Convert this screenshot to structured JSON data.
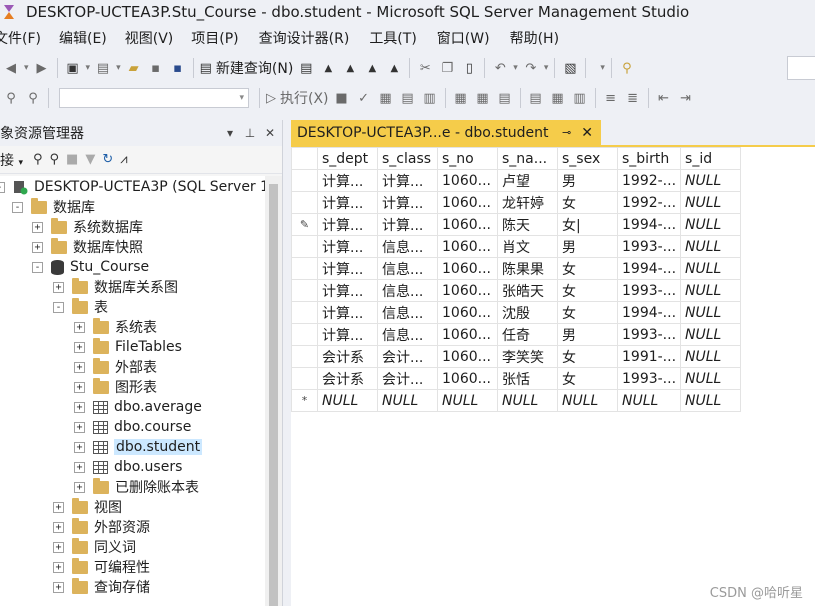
{
  "window": {
    "title": "DESKTOP-UCTEA3P.Stu_Course - dbo.student - Microsoft SQL Server Management Studio"
  },
  "menu": [
    "文件(F)",
    "编辑(E)",
    "视图(V)",
    "项目(P)",
    "查询设计器(R)",
    "工具(T)",
    "窗口(W)",
    "帮助(H)"
  ],
  "toolbar": {
    "new_query_label": "新建查询(N)",
    "execute_label": "执行(X)"
  },
  "object_explorer": {
    "title": "对象资源管理器",
    "connect_label": "连接",
    "tree": [
      {
        "label": "DESKTOP-UCTEA3P (SQL Server 1",
        "expander": "-"
      },
      {
        "label": "数据库",
        "expander": "-"
      },
      {
        "label": "系统数据库",
        "expander": "+"
      },
      {
        "label": "数据库快照",
        "expander": "+"
      },
      {
        "label": "Stu_Course",
        "expander": "-"
      },
      {
        "label": "数据库关系图",
        "expander": "+"
      },
      {
        "label": "表",
        "expander": "-"
      },
      {
        "label": "系统表",
        "expander": "+"
      },
      {
        "label": "FileTables",
        "expander": "+"
      },
      {
        "label": "外部表",
        "expander": "+"
      },
      {
        "label": "图形表",
        "expander": "+"
      },
      {
        "label": "dbo.average",
        "expander": "+"
      },
      {
        "label": "dbo.course",
        "expander": "+"
      },
      {
        "label": "dbo.student",
        "expander": "+"
      },
      {
        "label": "dbo.users",
        "expander": "+"
      },
      {
        "label": "已删除账本表",
        "expander": "+"
      },
      {
        "label": "视图",
        "expander": "+"
      },
      {
        "label": "外部资源",
        "expander": "+"
      },
      {
        "label": "同义词",
        "expander": "+"
      },
      {
        "label": "可编程性",
        "expander": "+"
      },
      {
        "label": "查询存储",
        "expander": "+"
      }
    ]
  },
  "document_tab": {
    "label": "DESKTOP-UCTEA3P...e - dbo.student",
    "pin": "⊸",
    "close": "✕"
  },
  "grid": {
    "columns": [
      "s_dept",
      "s_class",
      "s_no",
      "s_na...",
      "s_sex",
      "s_birth",
      "s_id"
    ],
    "rows": [
      {
        "marker": "",
        "cells": [
          "计算...",
          "计算...",
          "1060...",
          "卢望",
          "男",
          "1992-...",
          "NULL"
        ]
      },
      {
        "marker": "",
        "cells": [
          "计算...",
          "计算...",
          "1060...",
          "龙轩婷",
          "女",
          "1992-...",
          "NULL"
        ]
      },
      {
        "marker": "✎",
        "cells": [
          "计算...",
          "计算...",
          "1060...",
          "陈天",
          "女|",
          "1994-...",
          "NULL"
        ]
      },
      {
        "marker": "",
        "cells": [
          "计算...",
          "信息...",
          "1060...",
          "肖文",
          "男",
          "1993-...",
          "NULL"
        ]
      },
      {
        "marker": "",
        "cells": [
          "计算...",
          "信息...",
          "1060...",
          "陈果果",
          "女",
          "1994-...",
          "NULL"
        ]
      },
      {
        "marker": "",
        "cells": [
          "计算...",
          "信息...",
          "1060...",
          "张皓天",
          "女",
          "1993-...",
          "NULL"
        ]
      },
      {
        "marker": "",
        "cells": [
          "计算...",
          "信息...",
          "1060...",
          "沈殷",
          "女",
          "1994-...",
          "NULL"
        ]
      },
      {
        "marker": "",
        "cells": [
          "计算...",
          "信息...",
          "1060...",
          "任奇",
          "男",
          "1993-...",
          "NULL"
        ]
      },
      {
        "marker": "",
        "cells": [
          "会计系",
          "会计...",
          "1060...",
          "李笑笑",
          "女",
          "1991-...",
          "NULL"
        ]
      },
      {
        "marker": "",
        "cells": [
          "会计系",
          "会计...",
          "1060...",
          "张恬",
          "女",
          "1993-...",
          "NULL"
        ]
      },
      {
        "marker": "*",
        "cells": [
          "NULL",
          "NULL",
          "NULL",
          "NULL",
          "NULL",
          "NULL",
          "NULL"
        ]
      }
    ]
  },
  "watermark": "CSDN @哈听星",
  "colors": {
    "tab_accent": "#f5cc4a",
    "selection": "#cce8ff",
    "folder": "#dcb35c"
  }
}
